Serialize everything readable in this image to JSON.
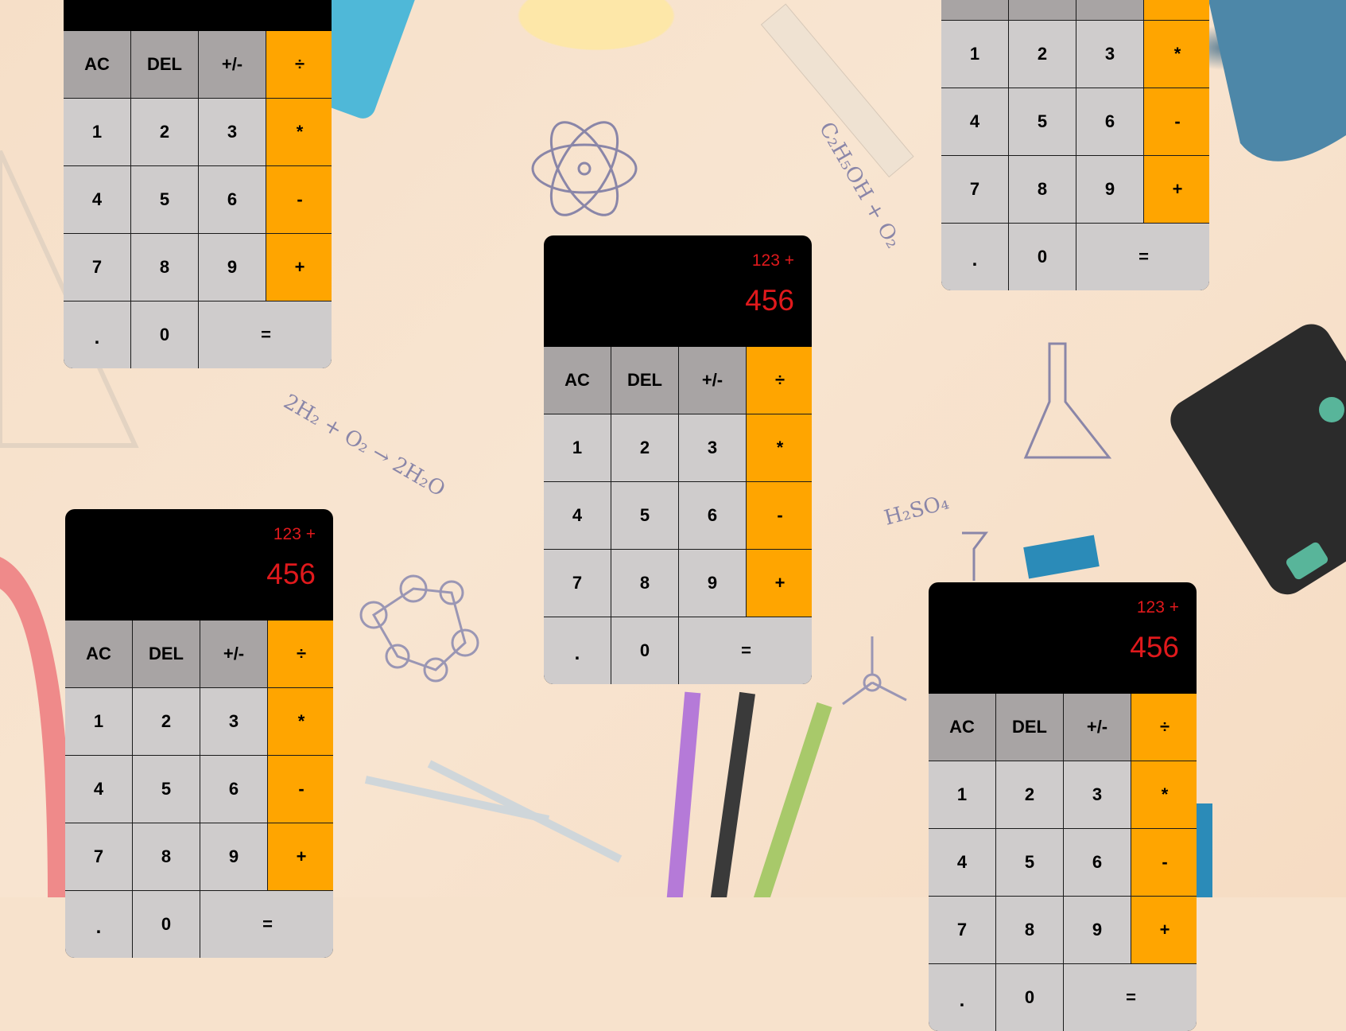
{
  "display": {
    "previous": "123 +",
    "current": "456"
  },
  "keys": {
    "ac": "AC",
    "del": "DEL",
    "negate": "+/-",
    "divide": "÷",
    "one": "1",
    "two": "2",
    "three": "3",
    "multiply": "*",
    "four": "4",
    "five": "5",
    "six": "6",
    "subtract": "-",
    "seven": "7",
    "eight": "8",
    "nine": "9",
    "add": "+",
    "decimal": ".",
    "zero": "0",
    "equals": "="
  },
  "colors": {
    "display_bg": "#000000",
    "display_text": "#e0191c",
    "function_key": "#a8a4a4",
    "number_key": "#cfcccc",
    "operator_key": "#ffa500"
  },
  "background": {
    "scene": "school supplies and science doodles on peach desk",
    "doodles": [
      "2H₂ + O₂ → 2H₂O",
      "C₂H₅OH + O₂",
      "H₂SO₄"
    ]
  }
}
